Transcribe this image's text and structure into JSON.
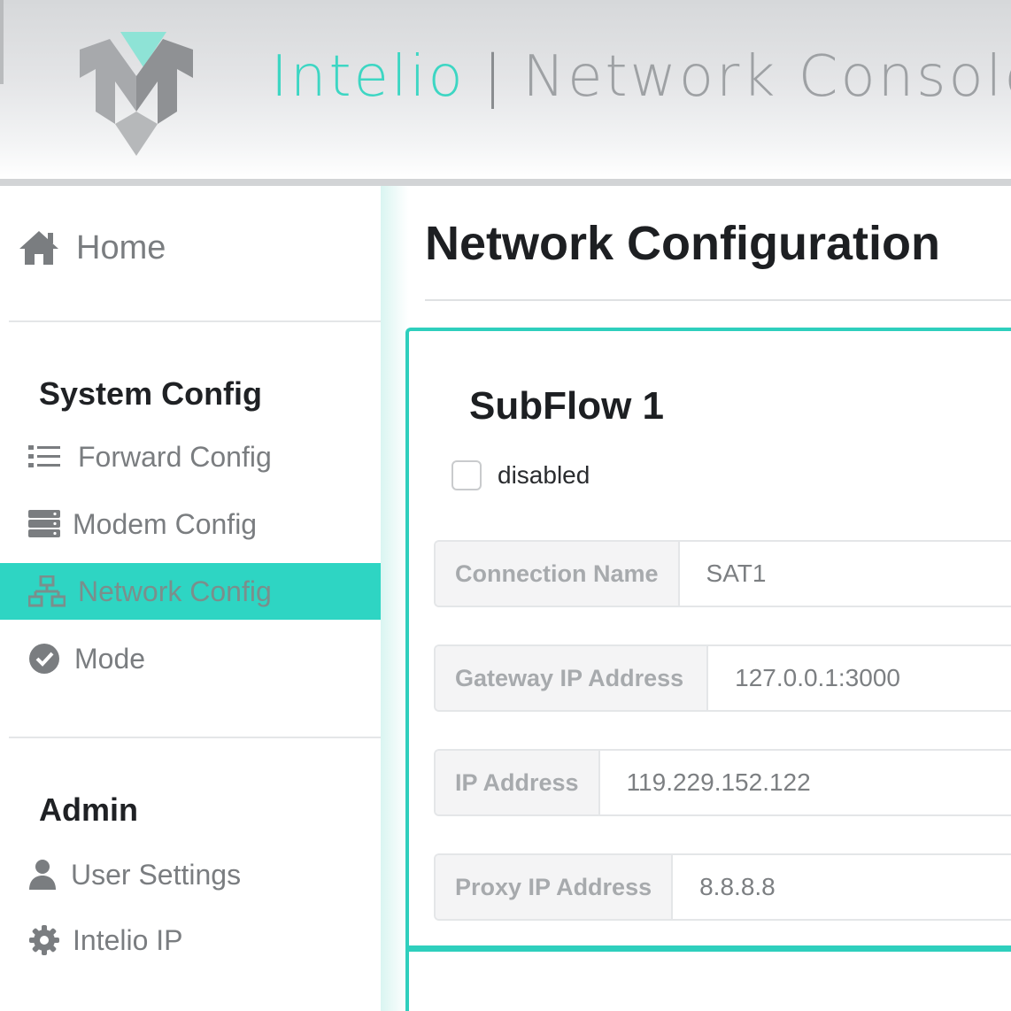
{
  "header": {
    "brand_name": "Intelio",
    "separator": "|",
    "console_name": "Network Console",
    "logo_icon": "intelio-logo-icon"
  },
  "sidebar": {
    "home": {
      "label": "Home",
      "icon": "home-icon"
    },
    "sections": [
      {
        "title": "System Config",
        "items": [
          {
            "label": "Forward Config",
            "icon": "list-icon"
          },
          {
            "label": "Modem Config",
            "icon": "server-icon"
          },
          {
            "label": "Network Config",
            "icon": "network-icon",
            "active": true
          },
          {
            "label": "Mode",
            "icon": "check-circle-icon"
          }
        ]
      },
      {
        "title": "Admin",
        "items": [
          {
            "label": "User Settings",
            "icon": "user-icon"
          },
          {
            "label": "Intelio IP",
            "icon": "gear-icon"
          }
        ]
      }
    ]
  },
  "main": {
    "title": "Network Configuration",
    "card": {
      "title": "SubFlow 1",
      "disabled_label": "disabled",
      "disabled_checked": false,
      "fields": [
        {
          "label": "Connection Name",
          "value": "SAT1"
        },
        {
          "label": "Gateway IP Address",
          "value": "127.0.0.1:3000"
        },
        {
          "label": "IP Address",
          "value": "119.229.152.122"
        },
        {
          "label": "Proxy IP Address",
          "value": "8.8.8.8"
        }
      ]
    }
  },
  "colors": {
    "accent": "#2ed5c3",
    "brand_teal": "#3dd6c3",
    "text_dark": "#1d1f22",
    "text_muted": "#7a7d80"
  }
}
